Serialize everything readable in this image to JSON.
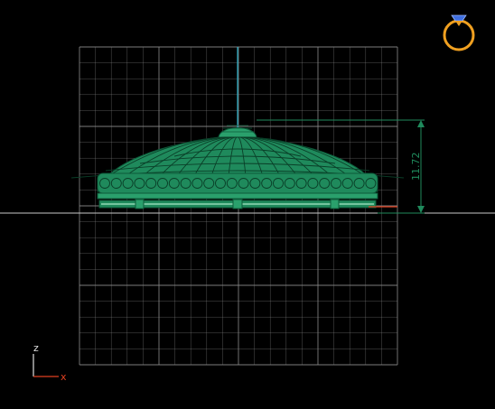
{
  "viewport": {
    "view_name": "front",
    "background": "#000000",
    "grid_color": "#8a8a8a",
    "model_color": "#1f8a5c",
    "ground_line_color": "#c8c8c8"
  },
  "dimension": {
    "height_value": "11.72",
    "color": "#1f8a5c"
  },
  "axes": {
    "vertical_label": "z",
    "horizontal_label": "x",
    "vertical_color": "#e0e0e0",
    "horizontal_color": "#e04020"
  },
  "view_cube": {
    "icon": "ring-icon",
    "ring_color": "#f0a020",
    "gem_color": "#3f6fe0"
  }
}
